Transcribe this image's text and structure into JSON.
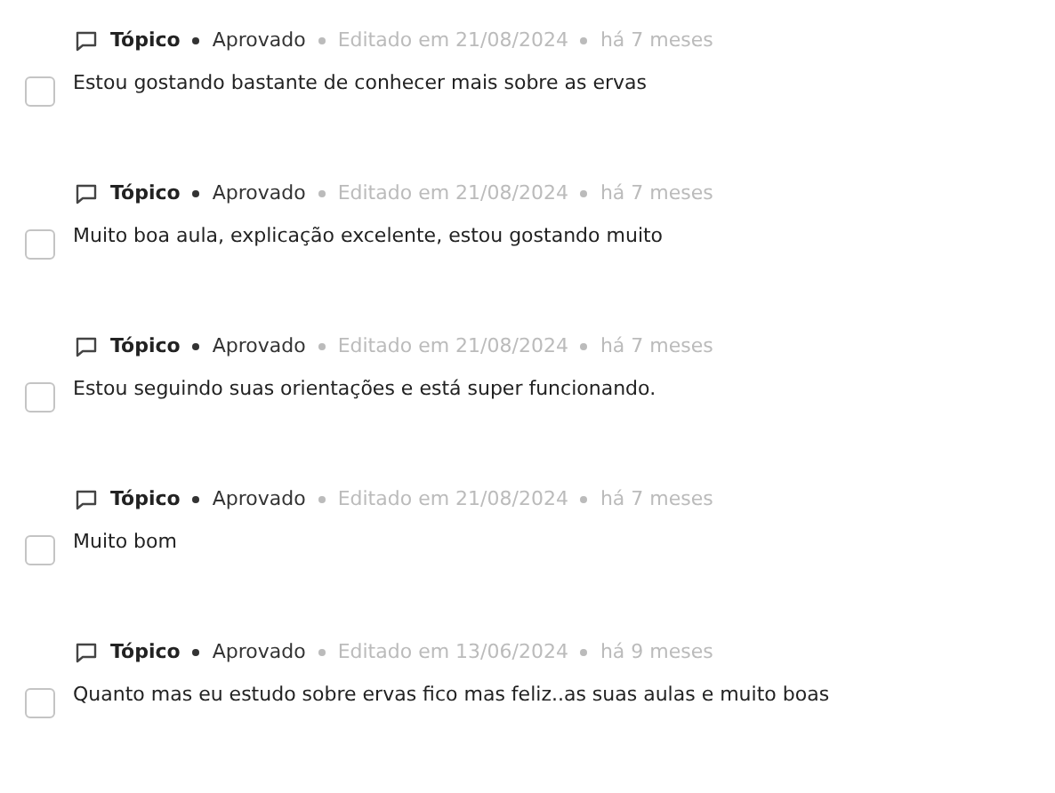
{
  "comments": [
    {
      "type": "Tópico",
      "status": "Aprovado",
      "edited": "Editado em 21/08/2024",
      "age": "há 7 meses",
      "text": "Estou gostando bastante de conhecer mais sobre as ervas",
      "checked": false
    },
    {
      "type": "Tópico",
      "status": "Aprovado",
      "edited": "Editado em 21/08/2024",
      "age": "há 7 meses",
      "text": "Muito boa aula, explicação excelente, estou gostando muito",
      "checked": false
    },
    {
      "type": "Tópico",
      "status": "Aprovado",
      "edited": "Editado em 21/08/2024",
      "age": "há 7 meses",
      "text": "Estou seguindo suas orientações e está super funcionando.",
      "checked": false
    },
    {
      "type": "Tópico",
      "status": "Aprovado",
      "edited": "Editado em 21/08/2024",
      "age": "há 7 meses",
      "text": "Muito bom",
      "checked": false
    },
    {
      "type": "Tópico",
      "status": "Aprovado",
      "edited": "Editado em 13/06/2024",
      "age": "há 9 meses",
      "text": "Quanto mas eu estudo sobre ervas fico mas feliz..as suas aulas e muito boas",
      "checked": false
    }
  ]
}
